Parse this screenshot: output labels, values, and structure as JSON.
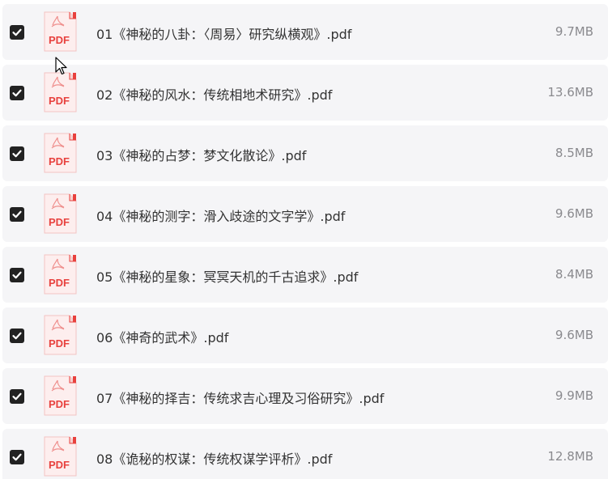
{
  "files": [
    {
      "name": "01《神秘的八卦：〈周易〉研究纵横观》.pdf",
      "size": "9.7MB",
      "checked": true,
      "icon": "pdf-icon",
      "icon_label": "PDF"
    },
    {
      "name": "02《神秘的风水：传统相地术研究》.pdf",
      "size": "13.6MB",
      "checked": true,
      "icon": "pdf-icon",
      "icon_label": "PDF"
    },
    {
      "name": "03《神秘的占梦：梦文化散论》.pdf",
      "size": "8.5MB",
      "checked": true,
      "icon": "pdf-icon",
      "icon_label": "PDF"
    },
    {
      "name": "04《神秘的测字：滑入歧途的文字学》.pdf",
      "size": "9.6MB",
      "checked": true,
      "icon": "pdf-icon",
      "icon_label": "PDF"
    },
    {
      "name": "05《神秘的星象：冥冥天机的千古追求》.pdf",
      "size": "8.4MB",
      "checked": true,
      "icon": "pdf-icon",
      "icon_label": "PDF"
    },
    {
      "name": "06《神奇的武术》.pdf",
      "size": "9.6MB",
      "checked": true,
      "icon": "pdf-icon",
      "icon_label": "PDF"
    },
    {
      "name": "07《神秘的择吉：传统求吉心理及习俗研究》.pdf",
      "size": "9.9MB",
      "checked": true,
      "icon": "pdf-icon",
      "icon_label": "PDF"
    },
    {
      "name": "08《诡秘的权谋：传统权谋学评析》.pdf",
      "size": "12.8MB",
      "checked": true,
      "icon": "pdf-icon",
      "icon_label": "PDF"
    }
  ],
  "colors": {
    "row_background": "#f5f5f7",
    "checkbox": "#222222",
    "pdf_red": "#e8413e",
    "pdf_page": "#fdeeee",
    "text": "#333333",
    "size_text": "#8a8a8e"
  }
}
